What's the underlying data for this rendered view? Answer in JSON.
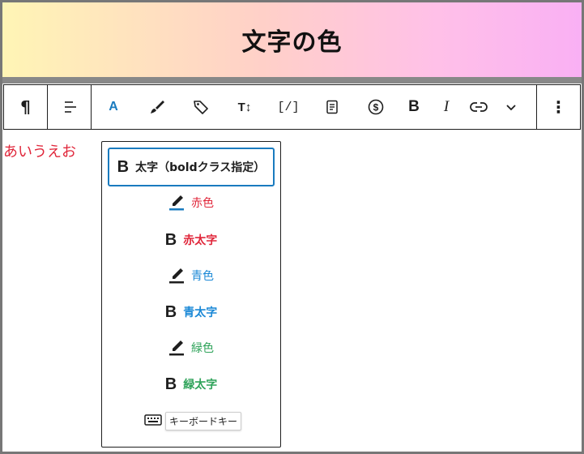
{
  "banner": {
    "title": "文字の色"
  },
  "toolbar": {
    "paragraph": "¶",
    "text_color_letter": "A",
    "bold": "B",
    "italic": "I",
    "typography": "T↕",
    "shortcode": "[/]",
    "more": "⋮",
    "accent_color": "#1a7bbf"
  },
  "editor": {
    "text": "あいうえお",
    "text_color": "#e0263a"
  },
  "menu": {
    "items": [
      {
        "label": "太字（boldクラス指定）",
        "icon": "bold-icon"
      },
      {
        "label": "赤色",
        "icon": "pen-icon"
      },
      {
        "label": "赤太字",
        "icon": "bold-icon"
      },
      {
        "label": "青色",
        "icon": "pen-icon"
      },
      {
        "label": "青太字",
        "icon": "bold-icon"
      },
      {
        "label": "緑色",
        "icon": "pen-icon"
      },
      {
        "label": "緑太字",
        "icon": "bold-icon"
      }
    ],
    "bold_glyph": "B",
    "shortcut_label": "キーボードキー",
    "colors": {
      "red": "#e0263a",
      "blue": "#1a88d6",
      "green": "#2fa35a"
    }
  }
}
